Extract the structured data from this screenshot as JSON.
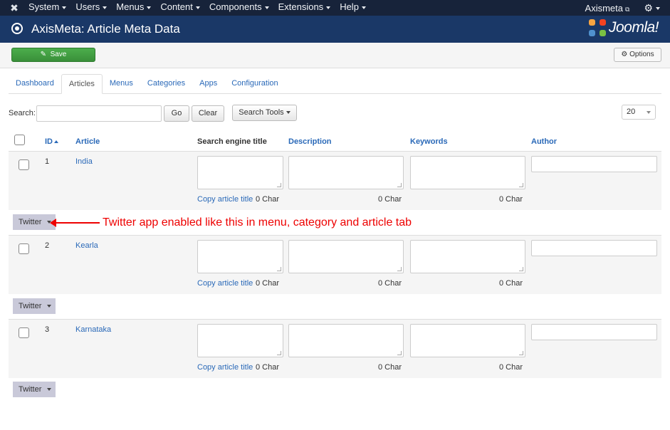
{
  "nav": {
    "logo_icon": "joomla-icon",
    "menu": [
      "System",
      "Users",
      "Menus",
      "Content",
      "Components",
      "Extensions",
      "Help"
    ],
    "site_name": "Axismeta",
    "gear_icon": "gear-icon"
  },
  "header": {
    "title": "AxisMeta: Article Meta Data",
    "brand": "Joomla!"
  },
  "toolbar": {
    "save_label": "Save",
    "options_label": "Options"
  },
  "tabs": [
    "Dashboard",
    "Articles",
    "Menus",
    "Categories",
    "Apps",
    "Configuration"
  ],
  "active_tab": "Articles",
  "search": {
    "label": "Search:",
    "value": "",
    "go_label": "Go",
    "clear_label": "Clear",
    "tools_label": "Search Tools",
    "limit_value": "20"
  },
  "table": {
    "columns": [
      "ID",
      "Article",
      "Search engine title",
      "Description",
      "Keywords",
      "Author"
    ],
    "copy_label": "Copy article title",
    "char_label": "0 Char",
    "twitter_label": "Twitter",
    "rows": [
      {
        "id": "1",
        "article": "India"
      },
      {
        "id": "2",
        "article": "Kearla"
      },
      {
        "id": "3",
        "article": "Karnataka"
      }
    ]
  },
  "annotation": "Twitter app enabled like this in menu, category and article tab",
  "colors": {
    "navbar": "#17233a",
    "header": "#1a3867",
    "link": "#2a69b8",
    "save": "#46a546",
    "annotation": "#e00000"
  }
}
